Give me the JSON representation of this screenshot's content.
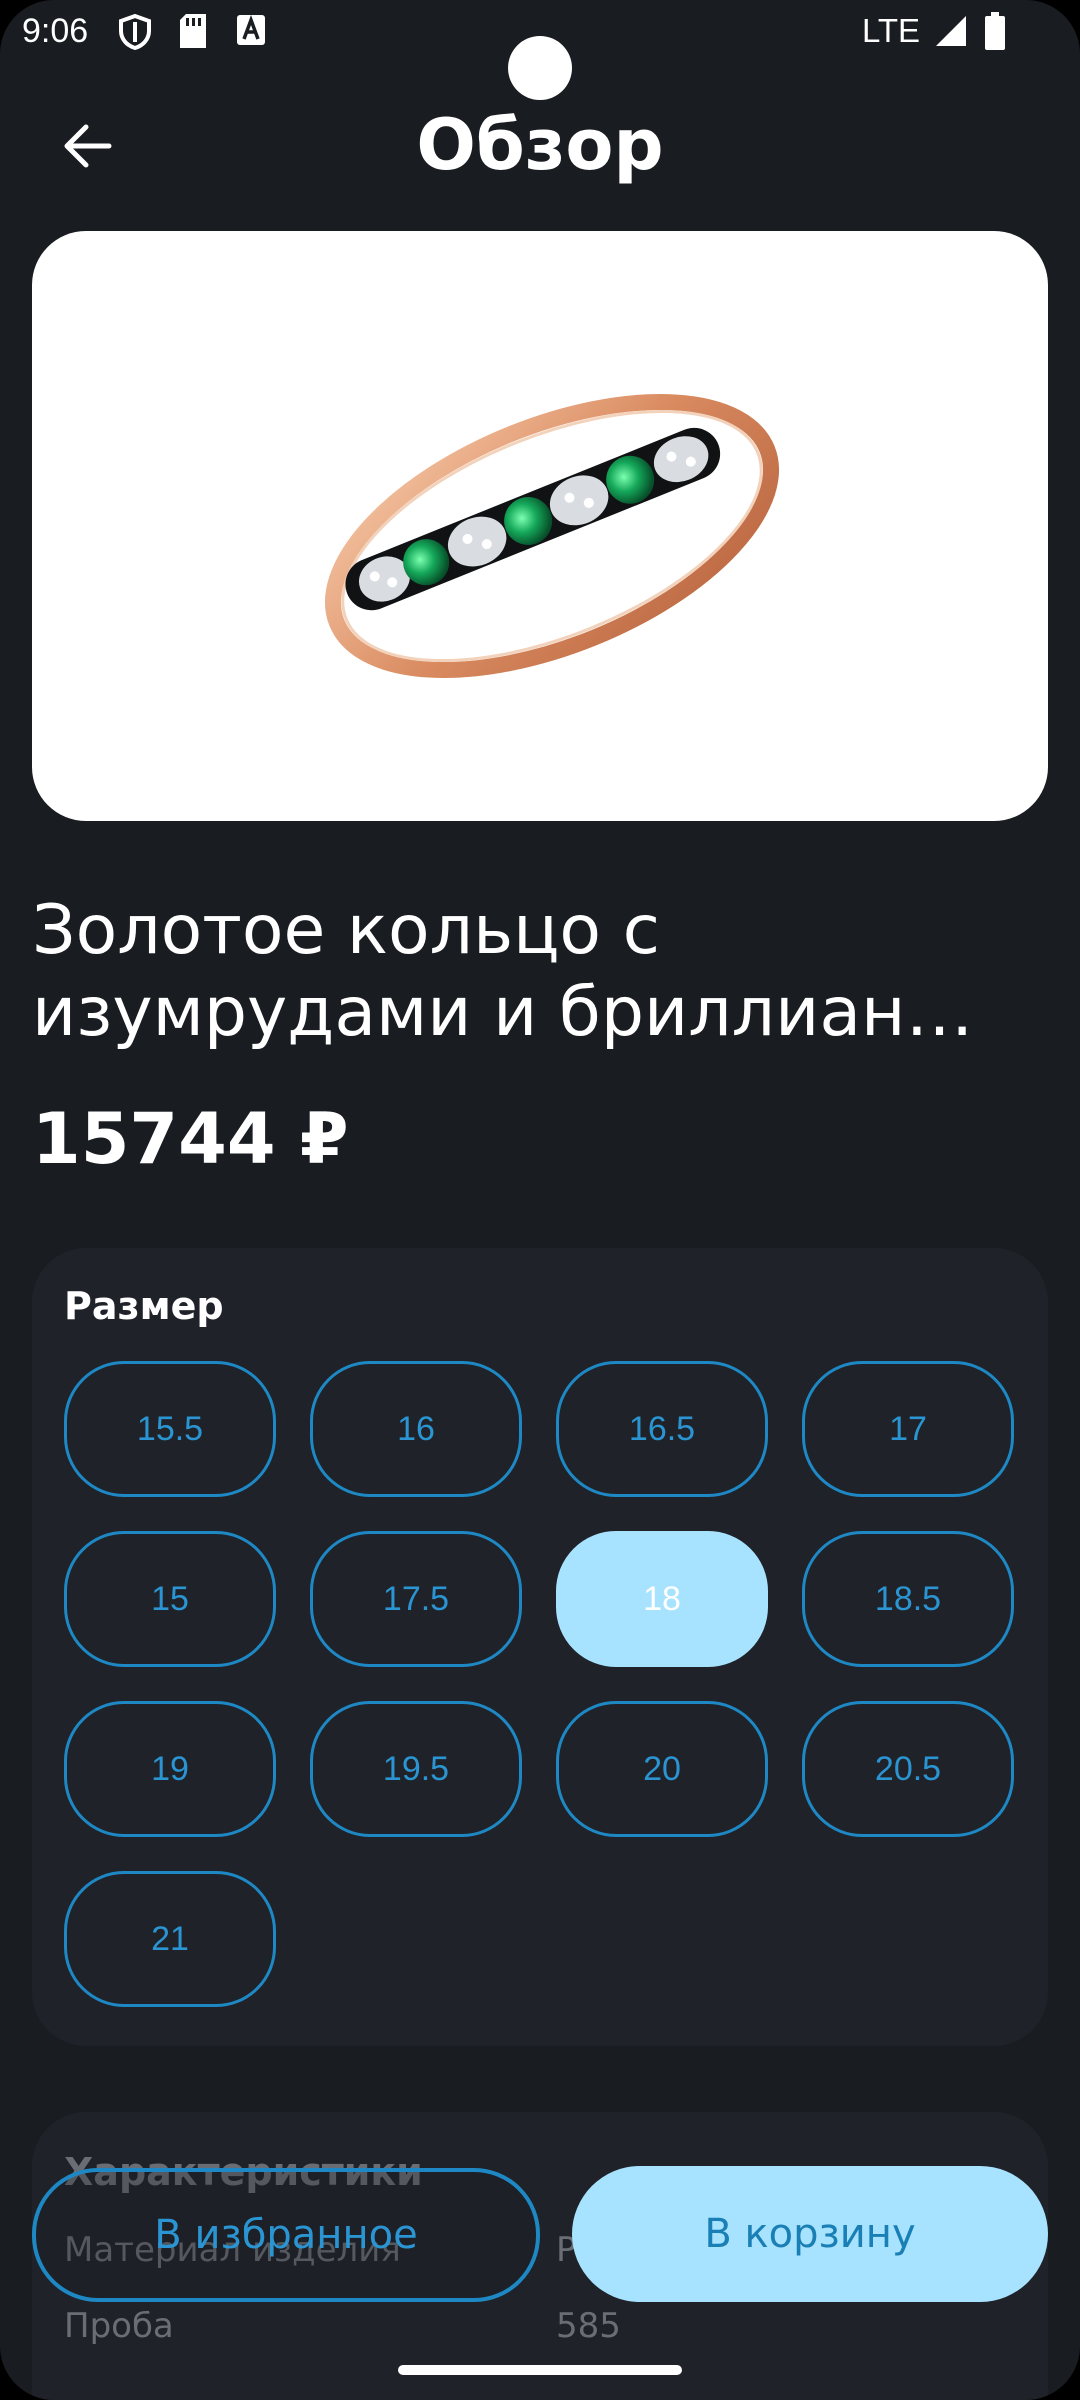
{
  "status_bar": {
    "time": "9:06",
    "network": "LTE"
  },
  "header": {
    "title": "Обзор"
  },
  "product": {
    "title_line1": "Золотое кольцо с",
    "title_line2": "изумрудами и бриллиан…",
    "price": "15744 ₽"
  },
  "size_section": {
    "title": "Размер",
    "sizes": [
      "15.5",
      "16",
      "16.5",
      "17",
      "15",
      "17.5",
      "18",
      "18.5",
      "19",
      "19.5",
      "20",
      "20.5",
      "21"
    ],
    "selected": "18"
  },
  "characteristics": {
    "title": "Характеристики",
    "rows": [
      {
        "label": "Материал изделия",
        "value": "Р"
      },
      {
        "label": "Проба",
        "value": "585"
      }
    ]
  },
  "actions": {
    "favorite_label": "В избранное",
    "cart_label": "В корзину"
  },
  "colors": {
    "background": "#191c21",
    "card": "#1f2228",
    "accent": "#a7e3ff",
    "outline": "#1e88c4"
  },
  "icons": {
    "back": "arrow-left-icon",
    "shield": "shield-icon",
    "sim": "sim-card-icon",
    "font": "font-a-icon",
    "signal": "signal-icon",
    "battery": "battery-icon"
  }
}
